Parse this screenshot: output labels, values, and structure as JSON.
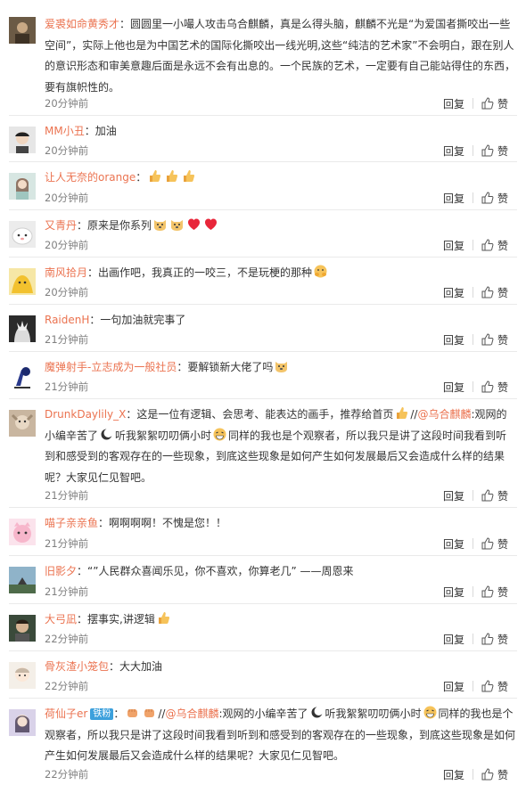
{
  "ui": {
    "reply_label": "回复",
    "like_label": "赞",
    "colon": "："
  },
  "comments": [
    {
      "user": "爱裘如命黄秀才",
      "parts": [
        "圆圆里一小嘬人攻击乌合麒麟，真是么得头脑，麒麟不光是“为爱国者撕咬出一些空间”，实际上他也是为中国艺术的国际化撕咬出一线光明,这些“纯洁的艺术家”不会明白，跟在别人的意识形态和审美意趣后面是永远不会有出息的。一个民族的艺术，一定要有自己能站得住的东西，要有旗帜性的。"
      ],
      "time": "20分钟前"
    },
    {
      "user": "MM小丑",
      "parts": [
        "加油"
      ],
      "time": "20分钟前"
    },
    {
      "user": "让人无奈的orange",
      "parts": [
        ""
      ],
      "time": "20分钟前"
    },
    {
      "user": "又青丹",
      "parts": [
        "原来是你系列"
      ],
      "time": "20分钟前"
    },
    {
      "user": "南风拾月",
      "parts": [
        "出画作吧，我真正的一咬三，不是玩梗的那种"
      ],
      "time": "20分钟前"
    },
    {
      "user": "RaidenH",
      "parts": [
        "一句加油就完事了"
      ],
      "time": "21分钟前"
    },
    {
      "user": "魔弹射手-立志成为一般社员",
      "parts": [
        "要解锁新大佬了吗"
      ],
      "time": "21分钟前"
    },
    {
      "user": "DrunkDaylily_X",
      "parts": [
        "这是一位有逻辑、会思考、能表达的画手，推荐给首页",
        "//",
        "@乌合麒麟",
        ":观网的小编辛苦了",
        "听我絮絮叨叨俩小时",
        "同样的我也是个观察者，所以我只是讲了这段时间我看到听到和感受到的客观存在的一些现象，到底这些现象是如何产生如何发展最后又会造成什么样的结果呢？大家见仁见智吧。"
      ],
      "time": "21分钟前"
    },
    {
      "user": "喵子亲亲鱼",
      "parts": [
        "啊啊啊啊！不愧是您！！"
      ],
      "time": "21分钟前"
    },
    {
      "user": "旧影夕",
      "parts": [
        "“”人民群众喜闻乐见，你不喜欢，你算老几” ——周恩来"
      ],
      "time": "21分钟前"
    },
    {
      "user": "大弓凪",
      "parts": [
        "摆事实,讲逻辑"
      ],
      "time": "22分钟前"
    },
    {
      "user": "骨灰渣小笼包",
      "parts": [
        "大大加油"
      ],
      "time": "22分钟前"
    },
    {
      "user": "荷仙子er",
      "badge": "铁粉",
      "parts": [
        "//",
        "@乌合麒麟",
        ":观网的小编辛苦了",
        "听我絮絮叨叨俩小时",
        "同样的我也是个观察者，所以我只是讲了这段时间我看到听到和感受到的客观存在的一些现象，到底这些现象是如何产生如何发展最后又会造成什么样的结果呢？大家见仁见智吧。"
      ],
      "time": "22分钟前"
    }
  ]
}
